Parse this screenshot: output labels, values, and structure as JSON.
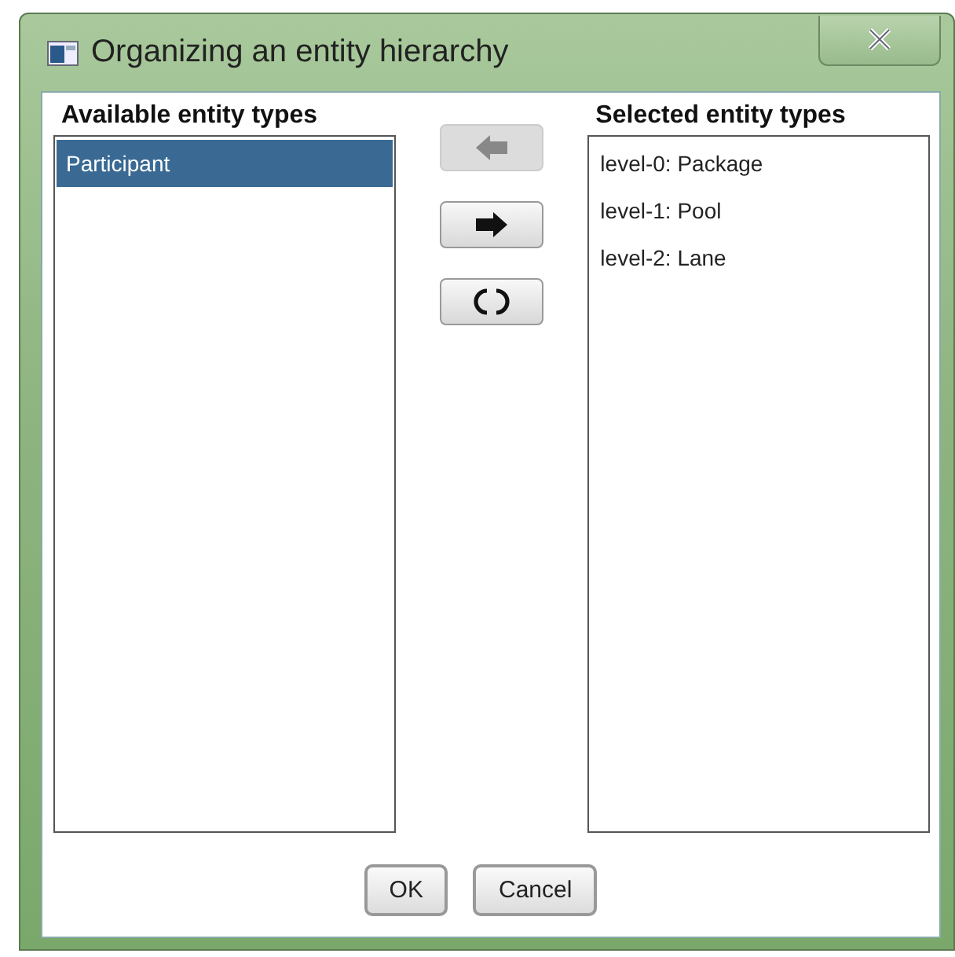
{
  "window": {
    "title": "Organizing an entity hierarchy"
  },
  "available": {
    "title": "Available entity types",
    "items": [
      {
        "label": "Participant",
        "selected": true
      }
    ]
  },
  "move_buttons": [
    {
      "kind": "left",
      "disabled": true
    },
    {
      "kind": "right",
      "disabled": false
    },
    {
      "kind": "swap",
      "disabled": false
    }
  ],
  "selected_list": {
    "title": "Selected entity types",
    "items": [
      {
        "label": "level-0: Package",
        "selected": false
      },
      {
        "label": "level-1: Pool",
        "selected": false
      },
      {
        "label": "level-2: Lane",
        "selected": false
      }
    ]
  },
  "buttons": [
    "OK",
    "Cancel"
  ]
}
